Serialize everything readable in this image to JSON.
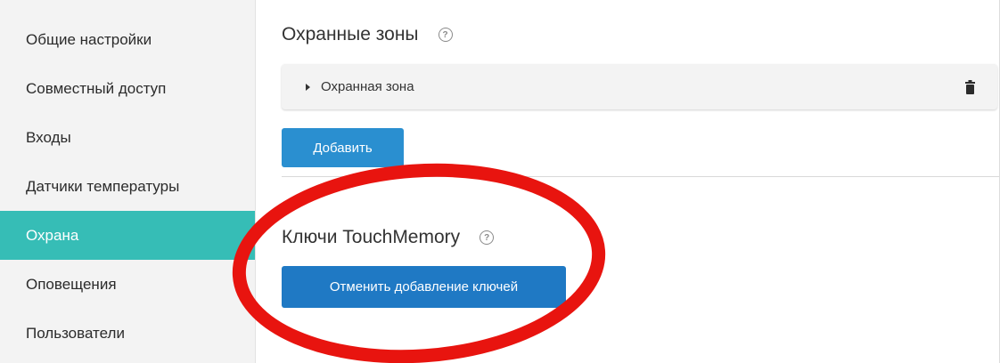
{
  "sidebar": {
    "items": [
      {
        "label": "Общие настройки"
      },
      {
        "label": "Совместный доступ"
      },
      {
        "label": "Входы"
      },
      {
        "label": "Датчики температуры"
      },
      {
        "label": "Охрана",
        "active": true
      },
      {
        "label": "Оповещения"
      },
      {
        "label": "Пользователи"
      }
    ]
  },
  "security_zones": {
    "title": "Охранные зоны",
    "help_icon": "question-circle-icon",
    "zone_label": "Охранная зона",
    "delete_icon": "trash-icon",
    "add_button": "Добавить"
  },
  "touchmemory": {
    "title": "Ключи TouchMemory",
    "help_icon": "question-circle-icon",
    "cancel_button": "Отменить добавление ключей"
  },
  "colors": {
    "active_item": "#36bdb6",
    "button_primary": "#2a8fd0",
    "annotation_red": "#e8140f"
  }
}
